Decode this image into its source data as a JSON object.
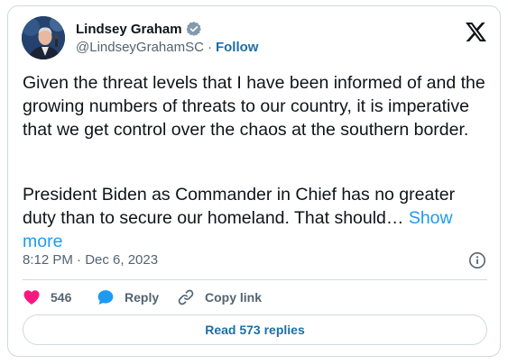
{
  "author": {
    "display_name": "Lindsey Graham",
    "handle": "@LindseyGrahamSC",
    "separator": "·",
    "follow_label": "Follow",
    "verified": true
  },
  "tweet": {
    "paragraph_1": "Given the threat levels that I have been informed of and the growing numbers of threats to our country, it is imperative that we get control over the chaos at the southern border.",
    "paragraph_2": "President Biden as Commander in Chief has no greater duty than to secure our homeland. That should…",
    "show_more_label": "Show more",
    "timestamp": "8:12 PM · Dec 6, 2023"
  },
  "actions": {
    "like_count": "546",
    "reply_label": "Reply",
    "copy_link_label": "Copy link"
  },
  "replies_button_label": "Read 573 replies",
  "icons": {
    "verified": "verified-badge-icon",
    "x_logo": "x-logo-icon",
    "info": "info-icon",
    "like": "heart-icon",
    "reply": "speech-bubble-icon",
    "copy_link": "link-icon"
  },
  "colors": {
    "link": "#1d9bf0",
    "follow": "#1d6fa5",
    "like": "#f91880",
    "reply": "#1d9bf0",
    "muted": "#536471",
    "border": "#cfd9de",
    "text": "#0f1419"
  }
}
